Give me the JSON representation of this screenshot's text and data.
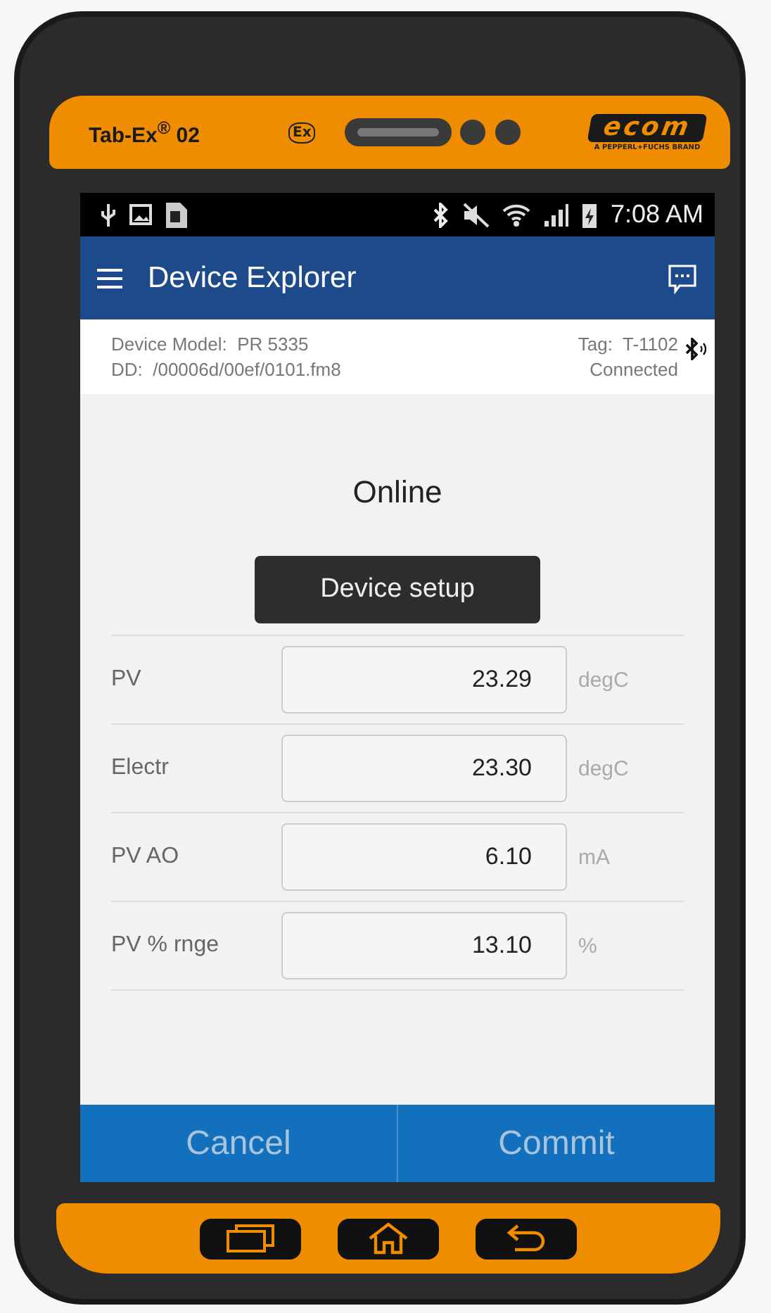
{
  "device": {
    "model_label": "Tab-Ex$^{®}$ 02",
    "ex_mark": "Ex",
    "brand": "ecom",
    "brand_tagline": "A PEPPERL+FUCHS BRAND"
  },
  "status_bar": {
    "time": "7:08 AM"
  },
  "app_bar": {
    "title": "Device Explorer"
  },
  "device_info": {
    "model_label": "Device Model:",
    "model": "PR 5335",
    "dd_label": "DD:",
    "dd": "/00006d/00ef/0101.fm8",
    "tag_label": "Tag:",
    "tag": "T-1102",
    "status": "Connected"
  },
  "mode": "Online",
  "setup_button": "Device setup",
  "variables": [
    {
      "label": "PV",
      "value": "23.29",
      "unit": "degC"
    },
    {
      "label": "Electr",
      "value": "23.30",
      "unit": "degC"
    },
    {
      "label": "PV AO",
      "value": "6.10",
      "unit": "mA"
    },
    {
      "label": "PV % rnge",
      "value": "13.10",
      "unit": "%"
    }
  ],
  "footer_buttons": [
    {
      "label": "Cancel",
      "disabled": true
    },
    {
      "label": "Commit",
      "disabled": true
    }
  ]
}
